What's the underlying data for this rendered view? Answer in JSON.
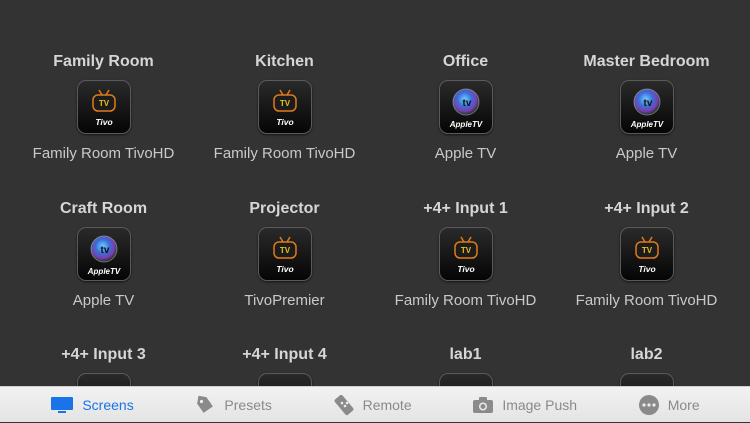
{
  "tiles": [
    {
      "room": "Family Room",
      "device": "Family Room TivoHD",
      "icon": "tivo-icon",
      "icon_label": "Tivo"
    },
    {
      "room": "Kitchen",
      "device": "Family Room TivoHD",
      "icon": "tivo-icon",
      "icon_label": "Tivo"
    },
    {
      "room": "Office",
      "device": "Apple TV",
      "icon": "appletv-icon",
      "icon_label": "AppleTV"
    },
    {
      "room": "Master Bedroom",
      "device": "Apple TV",
      "icon": "appletv-icon",
      "icon_label": "AppleTV"
    },
    {
      "room": "Craft Room",
      "device": "Apple TV",
      "icon": "appletv-icon",
      "icon_label": "AppleTV"
    },
    {
      "room": "Projector",
      "device": "TivoPremier",
      "icon": "tivo-icon",
      "icon_label": "Tivo"
    },
    {
      "room": "+4+ Input 1",
      "device": "Family Room TivoHD",
      "icon": "tivo-icon",
      "icon_label": "Tivo"
    },
    {
      "room": "+4+ Input 2",
      "device": "Family Room TivoHD",
      "icon": "tivo-icon",
      "icon_label": "Tivo"
    },
    {
      "room": "+4+ Input 3",
      "device": "",
      "icon": "tivo-icon",
      "icon_label": ""
    },
    {
      "room": "+4+ Input 4",
      "device": "",
      "icon": "tivo-icon",
      "icon_label": ""
    },
    {
      "room": "lab1",
      "device": "",
      "icon": "tivo-icon",
      "icon_label": ""
    },
    {
      "room": "lab2",
      "device": "",
      "icon": "appletv-icon",
      "icon_label": ""
    }
  ],
  "tabbar": {
    "screens": "Screens",
    "presets": "Presets",
    "remote": "Remote",
    "image_push": "Image Push",
    "more": "More"
  },
  "colors": {
    "background": "#333333",
    "active_tab": "#1a73e8",
    "inactive_tab": "#8a8a8a"
  }
}
